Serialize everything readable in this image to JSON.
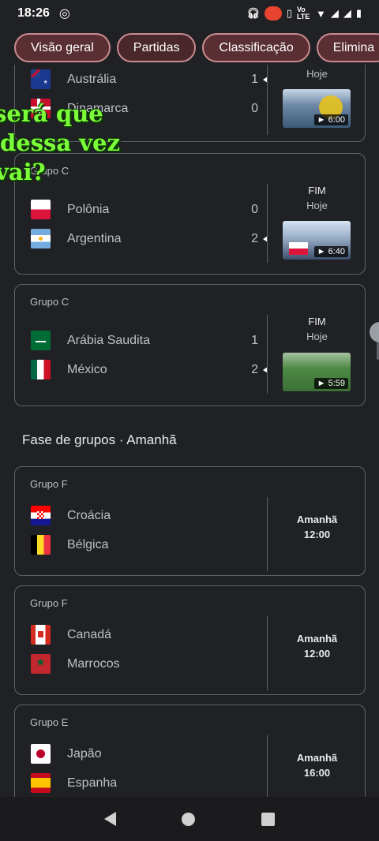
{
  "status_bar": {
    "time": "18:26",
    "network": "Vo LTE"
  },
  "tabs": [
    {
      "label": "Visão geral"
    },
    {
      "label": "Partidas"
    },
    {
      "label": "Classificação"
    },
    {
      "label": "Elimina"
    }
  ],
  "overlay": {
    "line1": "será que",
    "line2": "dessa vez",
    "line3": "vai?"
  },
  "matches_today": [
    {
      "group": "",
      "teams": [
        {
          "name": "Austrália",
          "score": "1",
          "flag": "au",
          "winner": true
        },
        {
          "name": "Dinamarca",
          "score": "0",
          "flag": "dk",
          "winner": false
        }
      ],
      "status": "",
      "status_sub": "Hoje",
      "video_duration": "6:00"
    },
    {
      "group": "Grupo C",
      "teams": [
        {
          "name": "Polônia",
          "score": "0",
          "flag": "pl",
          "winner": false
        },
        {
          "name": "Argentina",
          "score": "2",
          "flag": "ar",
          "winner": true
        }
      ],
      "status": "FIM",
      "status_sub": "Hoje",
      "video_duration": "6:40"
    },
    {
      "group": "Grupo C",
      "teams": [
        {
          "name": "Arábia Saudita",
          "score": "1",
          "flag": "sa",
          "winner": false
        },
        {
          "name": "México",
          "score": "2",
          "flag": "mx",
          "winner": true
        }
      ],
      "status": "FIM",
      "status_sub": "Hoje",
      "video_duration": "5:59"
    }
  ],
  "section_title": "Fase de grupos · Amanhã",
  "matches_tomorrow": [
    {
      "group": "Grupo F",
      "teams": [
        {
          "name": "Croácia",
          "flag": "hr"
        },
        {
          "name": "Bélgica",
          "flag": "be"
        }
      ],
      "day": "Amanhã",
      "time": "12:00"
    },
    {
      "group": "Grupo F",
      "teams": [
        {
          "name": "Canadá",
          "flag": "ca"
        },
        {
          "name": "Marrocos",
          "flag": "ma"
        }
      ],
      "day": "Amanhã",
      "time": "12:00"
    },
    {
      "group": "Grupo E",
      "teams": [
        {
          "name": "Japão",
          "flag": "jp"
        },
        {
          "name": "Espanha",
          "flag": "es"
        }
      ],
      "day": "Amanhã",
      "time": "16:00"
    }
  ]
}
